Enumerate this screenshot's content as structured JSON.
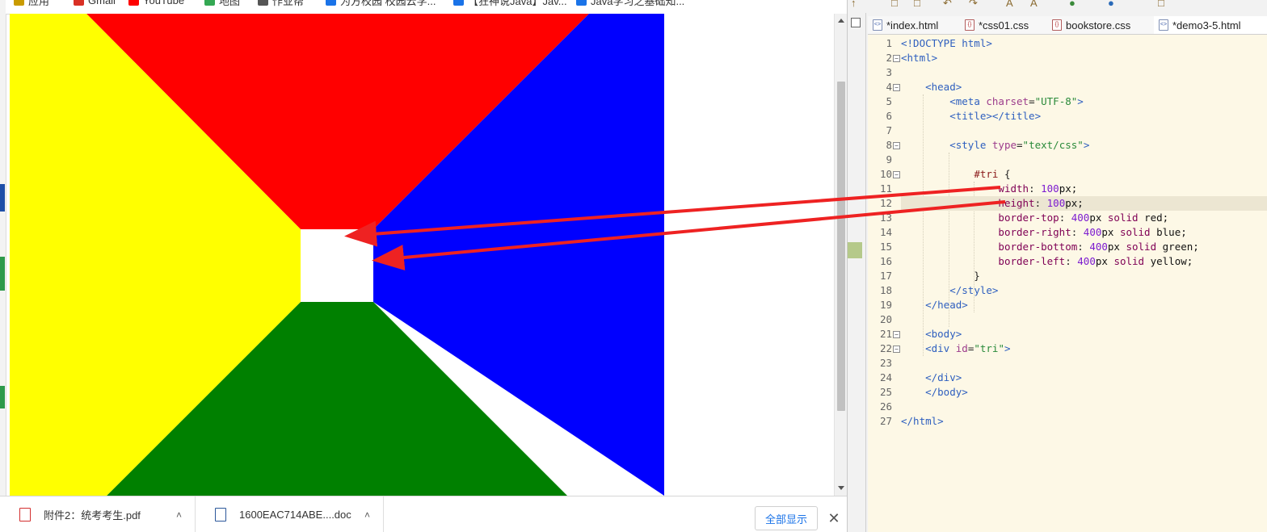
{
  "browser": {
    "bookmarks": [
      {
        "label": "应用",
        "icon": "apps-icon",
        "color": "#c99b00"
      },
      {
        "label": "Gmail",
        "icon": "gmail-icon",
        "color": "#d93025"
      },
      {
        "label": "YouTube",
        "icon": "youtube-icon",
        "color": "#ff0000"
      },
      {
        "label": "地图",
        "icon": "maps-icon",
        "color": "#34a853"
      },
      {
        "label": "作业帮",
        "icon": "globe-icon",
        "color": "#555555"
      },
      {
        "label": "为方校园 校园云学...",
        "icon": "page-icon",
        "color": "#1a73e8"
      },
      {
        "label": "【狂神说Java】Jav...",
        "icon": "page-icon",
        "color": "#1a73e8"
      },
      {
        "label": "Java学习之基础知...",
        "icon": "page-icon",
        "color": "#1a73e8"
      }
    ],
    "rendered_shape": {
      "description_colors": {
        "top": "#ff0000",
        "right": "#0000ff",
        "bottom": "#008000",
        "left": "#ffff00",
        "center": "#ffffff"
      }
    },
    "downloads": {
      "items": [
        {
          "name": "附件2：统考考生.pdf",
          "icon": "pdf-file-icon",
          "color": "#d32f2f"
        },
        {
          "name": "1600EAC714ABE....doc",
          "icon": "word-file-icon",
          "color": "#2b579a"
        }
      ],
      "show_all_label": "全部显示",
      "close_label": "✕"
    }
  },
  "editor": {
    "tabs": [
      {
        "label": "*index.html",
        "type": "html"
      },
      {
        "label": "*css01.css",
        "type": "css"
      },
      {
        "label": "bookstore.css",
        "type": "css"
      },
      {
        "label": "*demo3-5.html",
        "type": "html"
      }
    ],
    "highlighted_line": 12,
    "folds": [
      2,
      4,
      8,
      10,
      21,
      22
    ],
    "code_lines": [
      [
        [
          "t-tag",
          "<!DOCTYPE html>"
        ]
      ],
      [
        [
          "t-tag",
          "<html>"
        ]
      ],
      [],
      [
        [
          "t-plain",
          "    "
        ],
        [
          "t-tag",
          "<head>"
        ]
      ],
      [
        [
          "t-plain",
          "        "
        ],
        [
          "t-tag",
          "<meta "
        ],
        [
          "t-attr",
          "charset"
        ],
        [
          "t-plain",
          "="
        ],
        [
          "t-val",
          "\"UTF-8\""
        ],
        [
          "t-tag",
          ">"
        ]
      ],
      [
        [
          "t-plain",
          "        "
        ],
        [
          "t-tag",
          "<title></title>"
        ]
      ],
      [],
      [
        [
          "t-plain",
          "        "
        ],
        [
          "t-tag",
          "<style "
        ],
        [
          "t-attr",
          "type"
        ],
        [
          "t-plain",
          "="
        ],
        [
          "t-val",
          "\"text/css\""
        ],
        [
          "t-tag",
          ">"
        ]
      ],
      [],
      [
        [
          "t-plain",
          "            "
        ],
        [
          "t-sel",
          "#tri "
        ],
        [
          "t-plain",
          "{"
        ]
      ],
      [
        [
          "t-plain",
          "                "
        ],
        [
          "t-prop",
          "width"
        ],
        [
          "t-plain",
          ": "
        ],
        [
          "t-num",
          "100"
        ],
        [
          "t-kw",
          "px;"
        ]
      ],
      [
        [
          "t-plain",
          "                "
        ],
        [
          "t-prop",
          "height"
        ],
        [
          "t-plain",
          ": "
        ],
        [
          "t-num",
          "100"
        ],
        [
          "t-kw",
          "px;"
        ]
      ],
      [
        [
          "t-plain",
          "                "
        ],
        [
          "t-prop",
          "border-top"
        ],
        [
          "t-plain",
          ": "
        ],
        [
          "t-num",
          "400"
        ],
        [
          "t-kw",
          "px "
        ],
        [
          "t-prop",
          "solid"
        ],
        [
          "t-kw",
          " red;"
        ]
      ],
      [
        [
          "t-plain",
          "                "
        ],
        [
          "t-prop",
          "border-right"
        ],
        [
          "t-plain",
          ": "
        ],
        [
          "t-num",
          "400"
        ],
        [
          "t-kw",
          "px "
        ],
        [
          "t-prop",
          "solid"
        ],
        [
          "t-kw",
          " blue;"
        ]
      ],
      [
        [
          "t-plain",
          "                "
        ],
        [
          "t-prop",
          "border-bottom"
        ],
        [
          "t-plain",
          ": "
        ],
        [
          "t-num",
          "400"
        ],
        [
          "t-kw",
          "px "
        ],
        [
          "t-prop",
          "solid"
        ],
        [
          "t-kw",
          " green;"
        ]
      ],
      [
        [
          "t-plain",
          "                "
        ],
        [
          "t-prop",
          "border-left"
        ],
        [
          "t-plain",
          ": "
        ],
        [
          "t-num",
          "400"
        ],
        [
          "t-kw",
          "px "
        ],
        [
          "t-prop",
          "solid"
        ],
        [
          "t-kw",
          " yellow;"
        ]
      ],
      [
        [
          "t-plain",
          "            }"
        ]
      ],
      [
        [
          "t-plain",
          "        "
        ],
        [
          "t-tag",
          "</style>"
        ]
      ],
      [
        [
          "t-plain",
          "    "
        ],
        [
          "t-tag",
          "</head>"
        ]
      ],
      [],
      [
        [
          "t-plain",
          "    "
        ],
        [
          "t-tag",
          "<body>"
        ]
      ],
      [
        [
          "t-plain",
          "    "
        ],
        [
          "t-tag",
          "<div "
        ],
        [
          "t-attr",
          "id"
        ],
        [
          "t-plain",
          "="
        ],
        [
          "t-val",
          "\"tri\""
        ],
        [
          "t-tag",
          ">"
        ]
      ],
      [],
      [
        [
          "t-plain",
          "    "
        ],
        [
          "t-tag",
          "</div>"
        ]
      ],
      [
        [
          "t-plain",
          "    "
        ],
        [
          "t-tag",
          "</body>"
        ]
      ],
      [],
      [
        [
          "t-tag",
          "</html>"
        ]
      ]
    ]
  },
  "annotation": {
    "color": "#ee2222"
  }
}
